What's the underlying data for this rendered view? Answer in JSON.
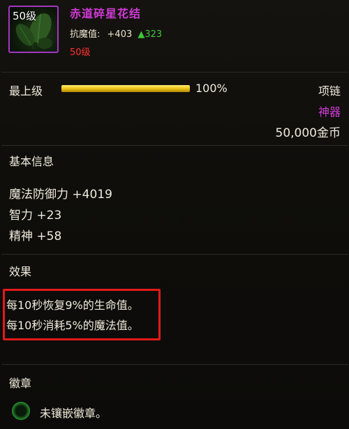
{
  "item": {
    "level_badge": "50级",
    "name": "赤道碎星花结",
    "resist_label": "抗魔值:",
    "resist_value": "+403",
    "resist_increase": "▲323",
    "required_level": "50级"
  },
  "upgrade": {
    "label": "最上级",
    "progress": 1.0,
    "percent_text": "100%"
  },
  "meta": {
    "slot_type": "项链",
    "quality": "神器",
    "price": "50,000金币"
  },
  "basic_info": {
    "title": "基本信息",
    "stats": [
      "魔法防御力 +4019",
      "智力 +23",
      "精神 +58"
    ]
  },
  "effects": {
    "title": "效果",
    "lines": [
      "每10秒恢复9%的生命值。",
      "每10秒消耗5%的魔法值。"
    ]
  },
  "emblem": {
    "title": "徽章",
    "status": "未镶嵌徽章。"
  },
  "colors": {
    "rarity_purple": "#d03ad6",
    "warning_red": "#ff3030",
    "increase_green": "#3fc83a",
    "highlight_box_red": "#e21a1a",
    "bar_gold": "#f2c61a"
  },
  "icons": {
    "item_icon": "leaf-necklace-icon",
    "socket_icon": "empty-socket-icon"
  }
}
